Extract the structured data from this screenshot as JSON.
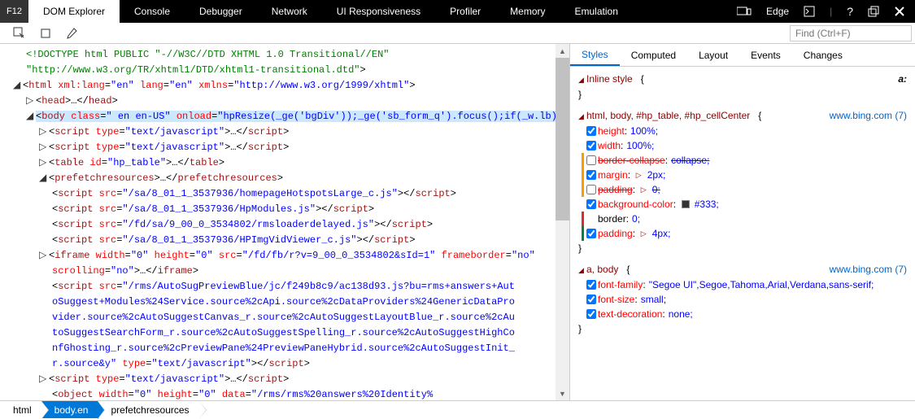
{
  "topbar": {
    "f12": "F12",
    "tabs": [
      "DOM Explorer",
      "Console",
      "Debugger",
      "Network",
      "UI Responsiveness",
      "Profiler",
      "Memory",
      "Emulation"
    ],
    "edge_label": "Edge"
  },
  "subbar": {
    "find_placeholder": "Find (Ctrl+F)"
  },
  "dom": {
    "line1a": "<!DOCTYPE html PUBLIC \"-//W3C//DTD XHTML 1.0 Transitional//EN\"",
    "line1b": "\"http://www.w3.org/TR/xhtml1/DTD/xhtml1-transitional.dtd\"",
    "line1c": ">",
    "html_open": "<",
    "html_tag": "html",
    "attr_xmllang": " xml:lang",
    "eq": "=",
    "val_en": "\"en\"",
    "attr_lang": " lang",
    "attr_xmlns": " xmlns",
    "val_xmlns": "\"http://www.w3.org/1999/xhtml\"",
    "gt": ">",
    "head_tag": "head",
    "ellipsis": "…",
    "head_close": "</",
    "body_tag": "body",
    "attr_class": " class",
    "val_class": "\" en en-US\"",
    "attr_onload": " onload",
    "val_onload": "\"hpResize(_ge('bgDiv'));_ge('sb_form_q').focus();if(_w.lb)lb();\"",
    "script_tag": "script",
    "attr_type": " type",
    "val_js": "\"text/javascript\"",
    "script_close": "</",
    "table_tag": "table",
    "attr_id": " id",
    "val_hptable": "\"hp_table\"",
    "table_close": "</",
    "pfr_tag": "prefetchresources",
    "attr_src": " src",
    "src1": "\"/sa/8_01_1_3537936/homepageHotspotsLarge_c.js\"",
    "src2": "\"/sa/8_01_1_3537936/HpModules.js\"",
    "src3": "\"/fd/sa/9_00_0_3534802/rmsloaderdelayed.js\"",
    "src4": "\"/sa/8_01_1_3537936/HPImgVidViewer_c.js\"",
    "iframe_tag": "iframe",
    "attr_width": " width",
    "val_0": "\"0\"",
    "attr_height": " height",
    "iframe_src": "\"/fd/fb/r?v=9_00_0_3534802&sId=1\"",
    "attr_frameborder": " frameborder",
    "val_no": "\"no\"",
    "attr_scrolling": "scrolling",
    "rms_src": "\"/rms/AutoSugPreviewBlue/jc/f249b8c9/ac138d93.js?bu=rms+answers+AutoSuggest+Modules%24Service.source%2cApi.source%2cDataProviders%24GenericDataProvider.source%2cAutoSuggestCanvas_r.source%2cAutoSuggestLayoutBlue_r.source%2cAutoSuggestSearchForm_r.source%2cAutoSuggestSpelling_r.source%2cAutoSuggestHighConfGhosting_r.source%2cPreviewPane%24PreviewPaneHybrid.source%2cAutoSuggestInit_r.source&y\"",
    "object_tag": "object",
    "attr_data": " data",
    "object_data": "\"/rms/rms%20answers%20Identity%"
  },
  "styles": {
    "tabs": [
      "Styles",
      "Computed",
      "Layout",
      "Events",
      "Changes"
    ],
    "inline_label": "Inline style",
    "brace_open": "{",
    "brace_close": "}",
    "rule1_selector": "html, body, #hp_table, #hp_cellCenter",
    "rule1_link": "www.bing.com (7)",
    "rule2_selector": "a, body",
    "rule2_link": "www.bing.com (7)",
    "p_height": "height",
    "v_height": "100%;",
    "p_width": "width",
    "v_width": "100%;",
    "p_bc": "border-collapse",
    "v_bc": "collapse;",
    "p_margin": "margin",
    "v_margin": "2px;",
    "p_padding": "padding",
    "v_padding": "0;",
    "p_bgcolor": "background-color",
    "v_bgcolor": "#333;",
    "p_border": "border",
    "v_border": "0;",
    "p_padding2": "padding",
    "v_padding2": "4px;",
    "p_ff": "font-family",
    "v_ff": "\"Segoe UI\",Segoe,Tahoma,Arial,Verdana,sans-serif;",
    "p_fs": "font-size",
    "v_fs": "small;",
    "p_td": "text-decoration",
    "v_td": "none;",
    "aa": "a:"
  },
  "breadcrumb": [
    "html",
    "body.en",
    "prefetchresources"
  ]
}
